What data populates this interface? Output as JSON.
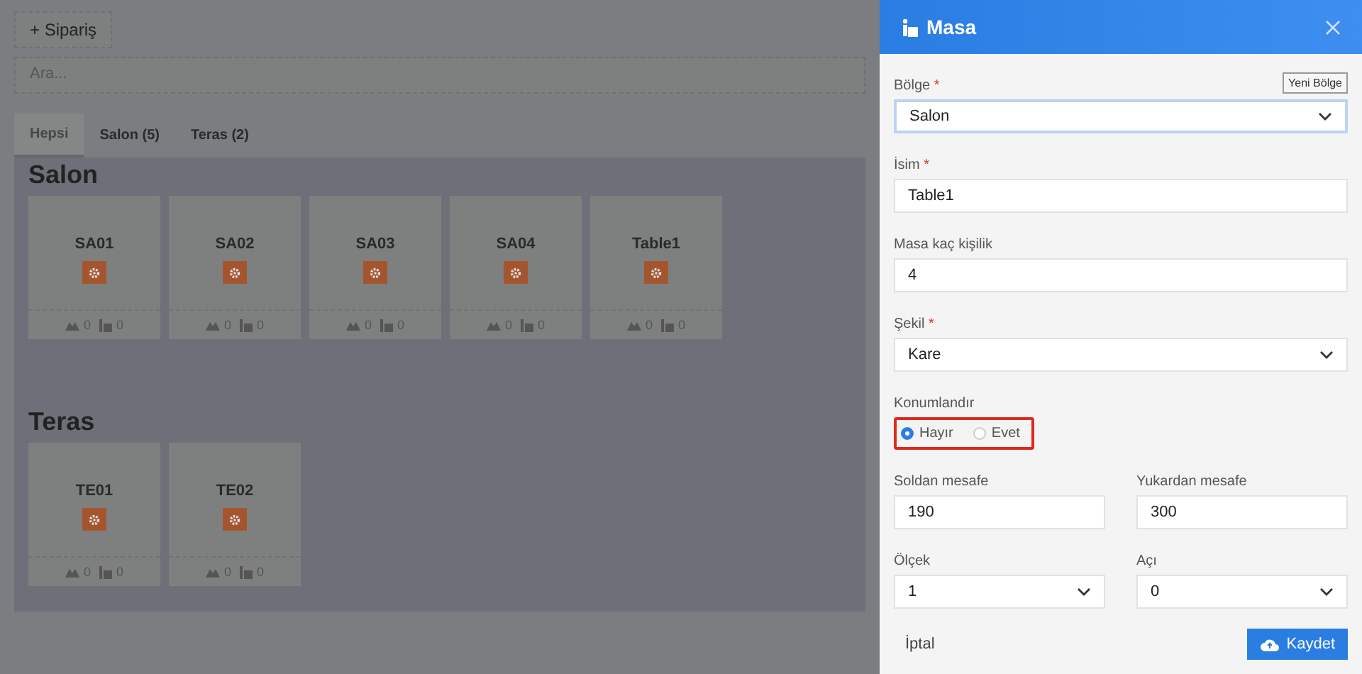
{
  "toolbar": {
    "new_order_button": "+ Sipariş",
    "search": {
      "placeholder": "Ara..."
    }
  },
  "tabs": [
    {
      "label": "Hepsi",
      "selected": true
    },
    {
      "label": "Salon (5)",
      "selected": false
    },
    {
      "label": "Teras (2)",
      "selected": false
    }
  ],
  "sections": [
    {
      "title": "Salon",
      "tables": [
        {
          "name": "SA01",
          "guests": "0",
          "seats": "0"
        },
        {
          "name": "SA02",
          "guests": "0",
          "seats": "0"
        },
        {
          "name": "SA03",
          "guests": "0",
          "seats": "0"
        },
        {
          "name": "SA04",
          "guests": "0",
          "seats": "0"
        },
        {
          "name": "Table1",
          "guests": "0",
          "seats": "0"
        }
      ]
    },
    {
      "title": "Teras",
      "tables": [
        {
          "name": "TE01",
          "guests": "0",
          "seats": "0"
        },
        {
          "name": "TE02",
          "guests": "0",
          "seats": "0"
        }
      ]
    }
  ],
  "drawer": {
    "title": "Masa",
    "new_region_button": "Yeni Bölge",
    "fields": [
      {
        "kind": "select",
        "label": "Bölge",
        "required_mark": "*",
        "value": "Salon",
        "focused": true
      },
      {
        "kind": "text",
        "label": "İsim",
        "required_mark": "*",
        "value": "Table1",
        "focused": false
      },
      {
        "kind": "text",
        "label": "Masa kaç kişilik",
        "value": "4",
        "focused": false
      },
      {
        "kind": "select",
        "label": "Şekil",
        "required_mark": "*",
        "value": "Kare",
        "focused": false
      }
    ],
    "positioning": {
      "label": "Konumlandır",
      "options": [
        {
          "label": "Hayır",
          "selected": true
        },
        {
          "label": "Evet",
          "selected": false
        }
      ]
    },
    "pairs": [
      [
        {
          "kind": "text",
          "label": "Soldan mesafe",
          "value": "190"
        },
        {
          "kind": "text",
          "label": "Yukardan mesafe",
          "value": "300"
        }
      ],
      [
        {
          "kind": "select",
          "label": "Ölçek",
          "value": "1"
        },
        {
          "kind": "select",
          "label": "Açı",
          "value": "0"
        }
      ]
    ],
    "cancel_button": "İptal",
    "save_button": "Kaydet"
  }
}
